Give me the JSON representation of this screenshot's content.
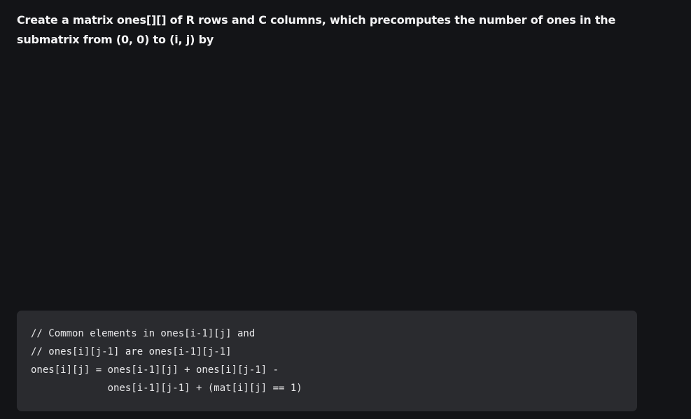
{
  "article": {
    "paragraph": "Create a matrix ones[][] of R rows and C columns, which precomputes the number of ones in the submatrix from (0, 0) to (i, j) by",
    "code_lines": [
      "// Common elements in ones[i-1][j] and",
      "// ones[i][j-1] are ones[i-1][j-1]",
      "ones[i][j] = ones[i-1][j] + ones[i][j-1] -",
      "             ones[i-1][j-1] + (mat[i][j] == 1)"
    ]
  }
}
